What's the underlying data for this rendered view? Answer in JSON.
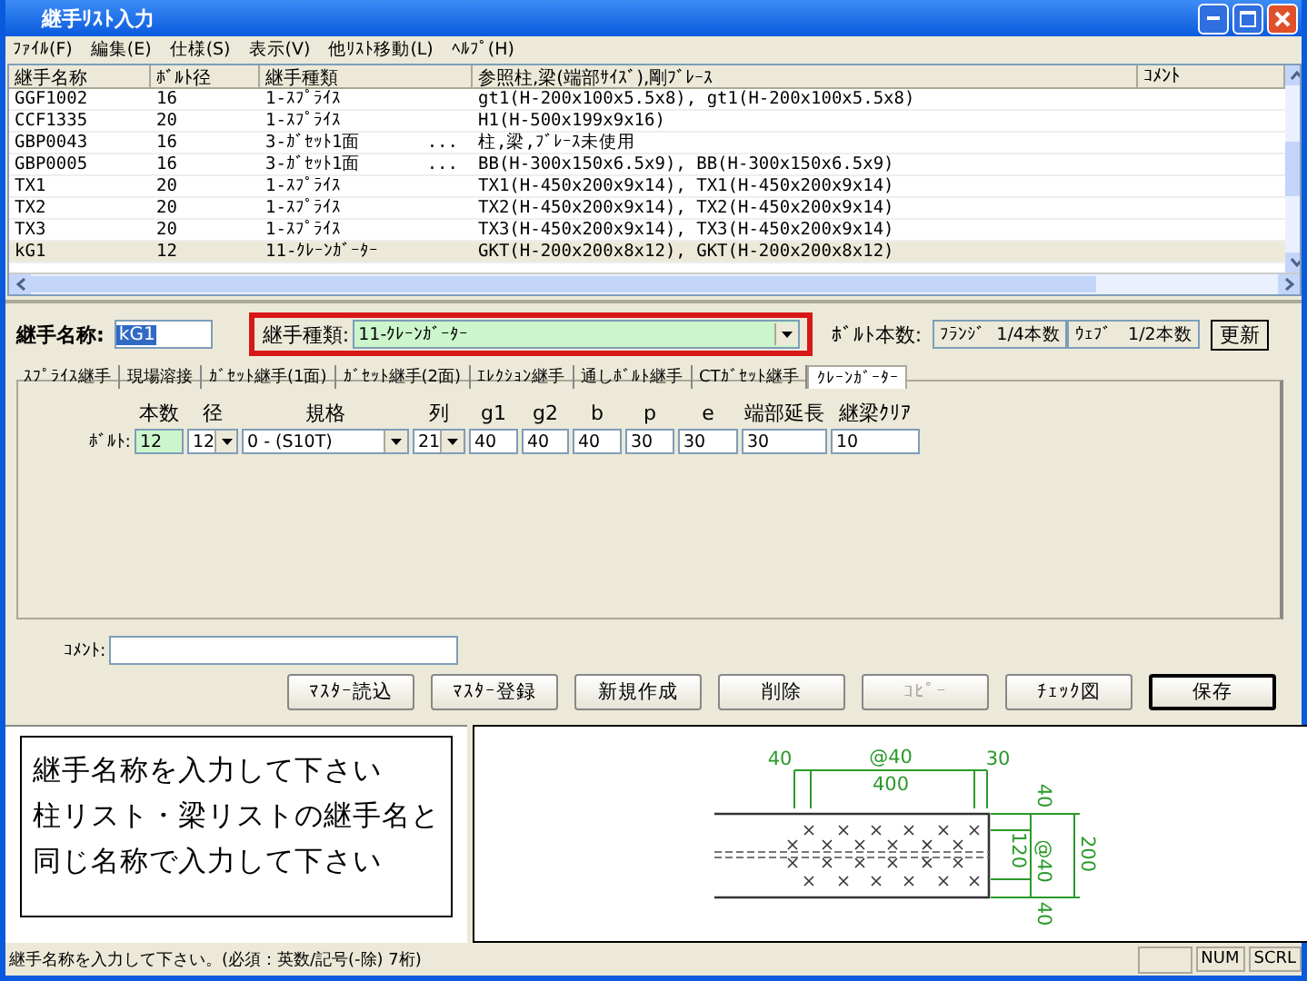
{
  "window": {
    "title": "継手ﾘｽﾄ入力"
  },
  "menu": [
    "ﾌｧｲﾙ(F)",
    "編集(E)",
    "仕様(S)",
    "表示(V)",
    "他ﾘｽﾄ移動(L)",
    "ﾍﾙﾌﾟ(H)"
  ],
  "table": {
    "columns": [
      "継手名称",
      "ﾎﾞﾙﾄ径",
      "継手種類",
      "参照柱,梁(端部ｻｲｽﾞ),剛ﾌﾞﾚｰｽ",
      "ｺﾒﾝﾄ"
    ],
    "rows": [
      {
        "name": "GGF1002",
        "bolt": "16",
        "type": "1-ｽﾌﾟﾗｲｽ",
        "reference": "gt1(H-200x100x5.5x8), gt1(H-200x100x5.5x8)",
        "selected": false
      },
      {
        "name": "CCF1335",
        "bolt": "20",
        "type": "1-ｽﾌﾟﾗｲｽ",
        "reference": "H1(H-500x199x9x16)",
        "selected": false
      },
      {
        "name": "GBP0043",
        "bolt": "16",
        "type": "3-ｶﾞｾｯﾄ1面",
        "marker": "...",
        "reference": "柱,梁,ﾌﾞﾚｰｽ未使用",
        "selected": false
      },
      {
        "name": "GBP0005",
        "bolt": "16",
        "type": "3-ｶﾞｾｯﾄ1面",
        "marker": "...",
        "reference": "BB(H-300x150x6.5x9), BB(H-300x150x6.5x9)",
        "selected": false
      },
      {
        "name": "TX1",
        "bolt": "20",
        "type": "1-ｽﾌﾟﾗｲｽ",
        "reference": "TX1(H-450x200x9x14), TX1(H-450x200x9x14)",
        "selected": false
      },
      {
        "name": "TX2",
        "bolt": "20",
        "type": "1-ｽﾌﾟﾗｲｽ",
        "reference": "TX2(H-450x200x9x14), TX2(H-450x200x9x14)",
        "selected": false
      },
      {
        "name": "TX3",
        "bolt": "20",
        "type": "1-ｽﾌﾟﾗｲｽ",
        "reference": "TX3(H-450x200x9x14), TX3(H-450x200x9x14)",
        "selected": false
      },
      {
        "name": "kG1",
        "bolt": "12",
        "type": "11-ｸﾚｰﾝｶﾞｰﾀｰ",
        "reference": "GKT(H-200x200x8x12), GKT(H-200x200x8x12)",
        "selected": true
      }
    ]
  },
  "form": {
    "name_label": "継手名称:",
    "name_value": "kG1",
    "type_label": "継手種類:",
    "type_value": "11-ｸﾚｰﾝｶﾞｰﾀｰ",
    "bolt_count_label": "ﾎﾞﾙﾄ本数:",
    "flange_count": "ﾌﾗﾝｼﾞ  1/4本数",
    "web_count": "ｳｪﾌﾞ   1/2本数",
    "update_button": "更新"
  },
  "tabs": [
    {
      "label": "ｽﾌﾟﾗｲｽ継手",
      "selected": false
    },
    {
      "label": "現場溶接",
      "selected": false
    },
    {
      "label": "ｶﾞｾｯﾄ継手(1面)",
      "selected": false
    },
    {
      "label": "ｶﾞｾｯﾄ継手(2面)",
      "selected": false
    },
    {
      "label": "ｴﾚｸｼｮﾝ継手",
      "selected": false
    },
    {
      "label": "通しﾎﾞﾙﾄ継手",
      "selected": false
    },
    {
      "label": "CTｶﾞｾｯﾄ継手",
      "selected": false
    },
    {
      "label": "ｸﾚｰﾝｶﾞｰﾀｰ",
      "selected": true
    }
  ],
  "bolt_params": {
    "row_label": "ﾎﾞﾙﾄ:",
    "fields": [
      {
        "header": "本数",
        "value": "12",
        "kind": "text",
        "highlighted": true
      },
      {
        "header": "径",
        "value": "12",
        "kind": "combo",
        "highlighted": false
      },
      {
        "header": "規格",
        "value": "0 - (S10T)",
        "kind": "combo",
        "highlighted": false
      },
      {
        "header": "列",
        "value": "21",
        "kind": "combo",
        "highlighted": false
      },
      {
        "header": "g1",
        "value": "40",
        "kind": "text",
        "highlighted": false
      },
      {
        "header": "g2",
        "value": "40",
        "kind": "text",
        "highlighted": false
      },
      {
        "header": "b",
        "value": "40",
        "kind": "text",
        "highlighted": false
      },
      {
        "header": "p",
        "value": "30",
        "kind": "text",
        "highlighted": false
      },
      {
        "header": "e",
        "value": "30",
        "kind": "text",
        "highlighted": false
      },
      {
        "header": "端部延長",
        "value": "30",
        "kind": "text",
        "highlighted": false
      },
      {
        "header": "継梁ｸﾘｱ",
        "value": "10",
        "kind": "text",
        "highlighted": false
      }
    ]
  },
  "comment": {
    "label": "ｺﾒﾝﾄ:"
  },
  "buttons": [
    {
      "label": "ﾏｽﾀｰ読込",
      "disabled": false,
      "default": false
    },
    {
      "label": "ﾏｽﾀｰ登録",
      "disabled": false,
      "default": false
    },
    {
      "label": "新規作成",
      "disabled": false,
      "default": false
    },
    {
      "label": "削除",
      "disabled": false,
      "default": false
    },
    {
      "label": "ｺﾋﾟｰ",
      "disabled": true,
      "default": false
    },
    {
      "label": "ﾁｪｯｸ図",
      "disabled": false,
      "default": false
    },
    {
      "label": "保存",
      "disabled": false,
      "default": true
    }
  ],
  "message": [
    "継手名称を入力して下さい",
    "柱リスト・梁リストの継手名と",
    "同じ名称で入力して下さい"
  ],
  "drawing": {
    "labels": [
      "40",
      "@40",
      "400",
      "30",
      "40",
      "@40",
      "120",
      "200",
      "40"
    ]
  },
  "status_bar": {
    "text": "継手名称を入力して下さい。(必須：英数/記号(-除) 7桁)",
    "indicators": [
      "NUM",
      "SCRL"
    ]
  }
}
